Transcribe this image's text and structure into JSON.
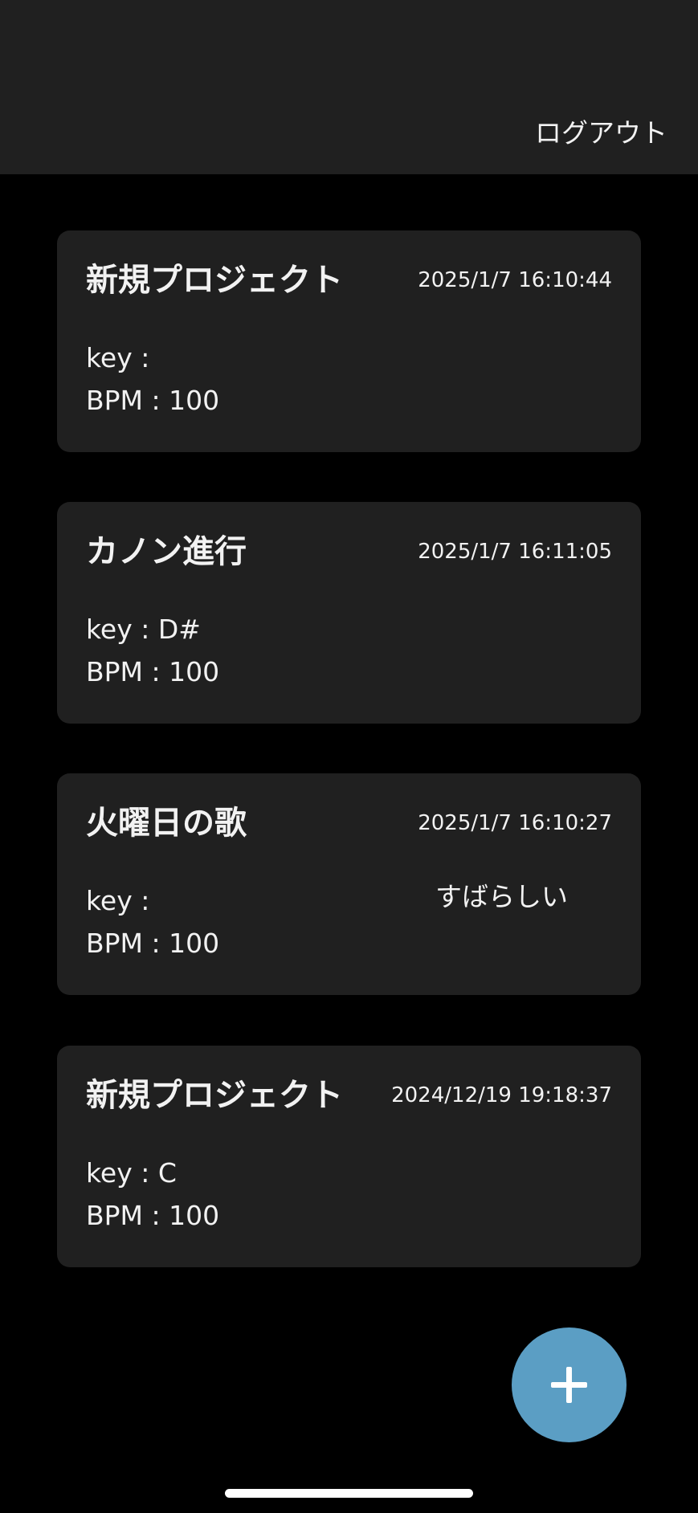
{
  "header": {
    "logout_label": "ログアウト"
  },
  "projects": [
    {
      "title": "新規プロジェクト",
      "date": "2025/1/7 16:10:44",
      "key": "key : ",
      "bpm": "BPM : 100",
      "comment": ""
    },
    {
      "title": "カノン進行",
      "date": "2025/1/7 16:11:05",
      "key": "key : D#",
      "bpm": "BPM : 100",
      "comment": ""
    },
    {
      "title": "火曜日の歌",
      "date": "2025/1/7 16:10:27",
      "key": "key : ",
      "bpm": "BPM : 100",
      "comment": "すばらしい"
    },
    {
      "title": "新規プロジェクト",
      "date": "2024/12/19 19:18:37",
      "key": "key : C",
      "bpm": "BPM : 100",
      "comment": ""
    }
  ],
  "fab": {
    "icon": "plus-icon"
  },
  "colors": {
    "background": "#000000",
    "surface": "#202020",
    "accent": "#5b9ec4",
    "text": "#f2f2f2"
  }
}
